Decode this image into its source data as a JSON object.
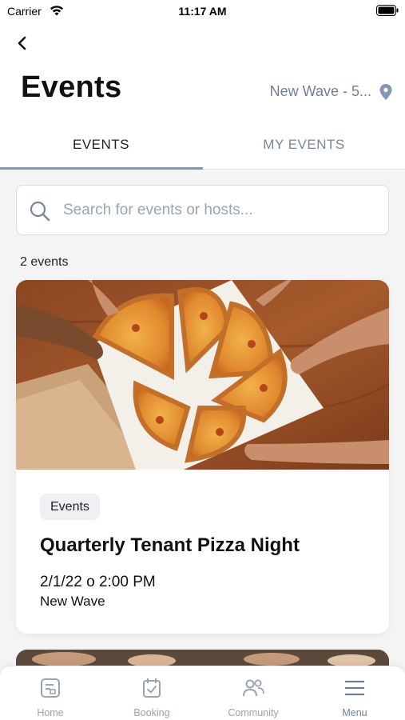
{
  "status_bar": {
    "carrier": "Carrier",
    "time": "11:17 AM"
  },
  "header": {
    "title": "Events",
    "location": "New Wave - 5..."
  },
  "tabs": [
    {
      "label": "EVENTS",
      "active": true
    },
    {
      "label": "MY EVENTS",
      "active": false
    }
  ],
  "search": {
    "placeholder": "Search for events or hosts..."
  },
  "events_count": "2 events",
  "events": [
    {
      "badge": "Events",
      "title": "Quarterly Tenant Pizza Night",
      "datetime": "2/1/22 o 2:00 PM",
      "location": "New Wave",
      "image": "pizza-image"
    }
  ],
  "bottom_nav": [
    {
      "label": "Home",
      "icon": "home-icon",
      "active": false
    },
    {
      "label": "Booking",
      "icon": "booking-icon",
      "active": false
    },
    {
      "label": "Community",
      "icon": "community-icon",
      "active": false
    },
    {
      "label": "Menu",
      "icon": "menu-icon",
      "active": true
    }
  ],
  "colors": {
    "accent": "#8497b8",
    "muted_text": "#6f7f99",
    "background": "#f4f4f4"
  }
}
